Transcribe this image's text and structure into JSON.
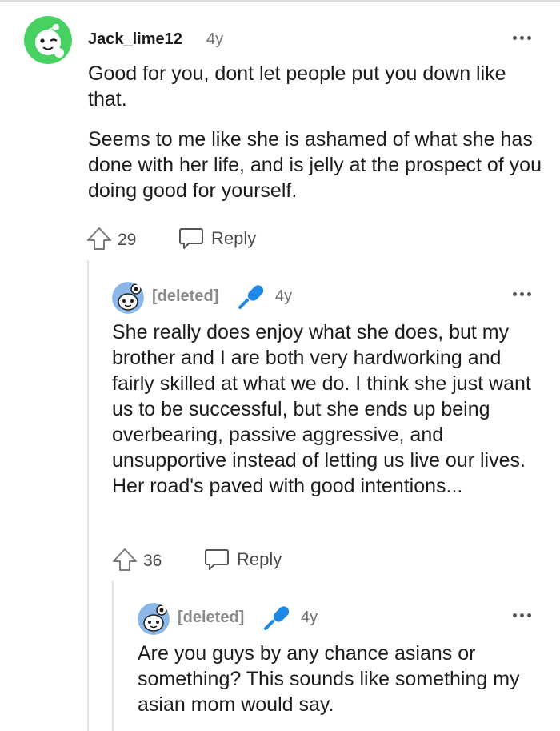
{
  "comments": [
    {
      "username": "Jack_lime12",
      "age": "4y",
      "paragraphs": [
        "Good for you, dont let people put you down like that.",
        "Seems to me like she is ashamed of what she has done with her life, and is jelly at the prospect of you doing good for yourself."
      ],
      "votes": "29",
      "reply_label": "Reply"
    },
    {
      "username": "[deleted]",
      "age": "4y",
      "text": "She really does enjoy what she does, but my brother and I are both very hardworking and fairly skilled at what we do. I think she just want us to be successful, but she ends up being overbearing, passive aggressive, and unsupportive instead of letting us live our lives. Her road's paved with good intentions...",
      "votes": "36",
      "reply_label": "Reply"
    },
    {
      "username": "[deleted]",
      "age": "4y",
      "text": "Are you guys by any chance asians or something? This sounds like something my asian mom would say."
    }
  ],
  "colors": {
    "avatar_green": "#46d160",
    "avatar_blue": "#8bb8e8",
    "mic_blue": "#1e88e5",
    "thread_line": "#e4e4e4"
  },
  "icons": {
    "upvote": "upvote-arrow-icon",
    "reply": "speech-bubble-icon",
    "more": "more-options-icon",
    "mic": "microphone-icon"
  }
}
